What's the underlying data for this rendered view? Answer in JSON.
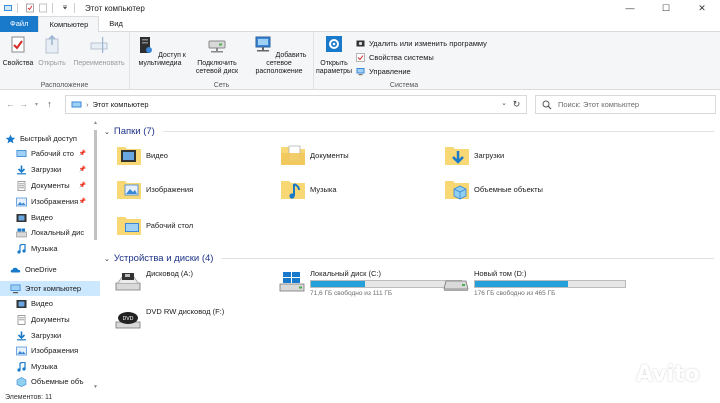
{
  "window": {
    "title": "Этот компьютер",
    "minimize_glyph": "—",
    "maximize_glyph": "☐",
    "close_glyph": "✕",
    "help_glyph": "?"
  },
  "ribbon": {
    "tabs": [
      {
        "label": "Файл"
      },
      {
        "label": "Компьютер"
      },
      {
        "label": "Вид"
      }
    ],
    "groups": {
      "location": {
        "label": "Расположение",
        "properties": "Свойства",
        "open": "Открыть",
        "rename": "Переименовать"
      },
      "network": {
        "label": "Сеть",
        "media_access": "Доступ к мультимедиа",
        "map_drive": "Подключить сетевой диск",
        "add_location": "Добавить сетевое расположение"
      },
      "system": {
        "label": "Система",
        "open_settings": "Открыть параметры",
        "uninstall": "Удалить или изменить программу",
        "system_props": "Свойства системы",
        "manage": "Управление"
      }
    }
  },
  "address": {
    "path": "Этот компьютер",
    "search_placeholder": "Поиск: Этот компьютер"
  },
  "nav": {
    "quick_access": "Быстрый доступ",
    "items": [
      {
        "label": "Рабочий сто",
        "pinned": true
      },
      {
        "label": "Загрузки",
        "pinned": true
      },
      {
        "label": "Документы",
        "pinned": true
      },
      {
        "label": "Изображения",
        "pinned": true
      },
      {
        "label": "Видео",
        "pinned": false
      },
      {
        "label": "Локальный дис",
        "pinned": false
      },
      {
        "label": "Музыка",
        "pinned": false
      }
    ],
    "onedrive": "OneDrive",
    "this_pc": "Этот компьютер",
    "pc_items": [
      {
        "label": "Видео"
      },
      {
        "label": "Документы"
      },
      {
        "label": "Загрузки"
      },
      {
        "label": "Изображения"
      },
      {
        "label": "Музыка"
      },
      {
        "label": "Объемные объ"
      }
    ]
  },
  "folders": {
    "header": "Папки (7)",
    "items": [
      {
        "label": "Видео"
      },
      {
        "label": "Документы"
      },
      {
        "label": "Загрузки"
      },
      {
        "label": "Изображения"
      },
      {
        "label": "Музыка"
      },
      {
        "label": "Объемные объекты"
      },
      {
        "label": "Рабочий стол"
      }
    ]
  },
  "drives": {
    "header": "Устройства и диски (4)",
    "items": [
      {
        "name": "Дисковод (A:)"
      },
      {
        "name": "Локальный диск (C:)",
        "free": "71,6 ГБ свободно из 111 ГБ",
        "used_fraction": 0.36
      },
      {
        "name": "Новый том (D:)",
        "free": "176 ГБ свободно из 465 ГБ",
        "used_fraction": 0.62
      },
      {
        "name": "DVD RW дисковод (F:)"
      }
    ]
  },
  "status": {
    "items_count": "Элементов: 11"
  },
  "watermark": {
    "text": "Avito"
  },
  "colors": {
    "accent": "#1979ca",
    "selection": "#cce8ff",
    "drive_bar": "#26a0da",
    "folder_yellow": "#f8d775",
    "section_header": "#1e3287"
  }
}
